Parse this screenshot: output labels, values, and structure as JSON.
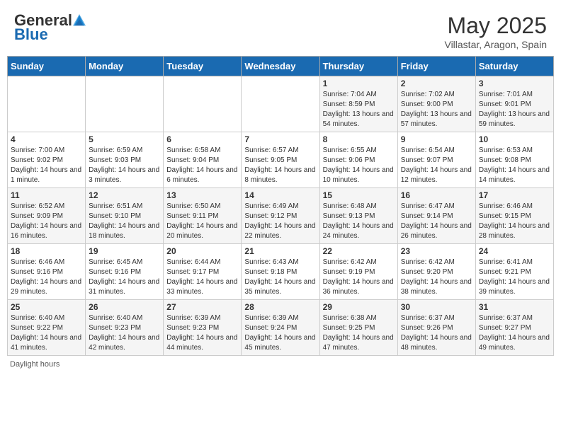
{
  "header": {
    "logo_general": "General",
    "logo_blue": "Blue",
    "month_year": "May 2025",
    "location": "Villastar, Aragon, Spain"
  },
  "days_of_week": [
    "Sunday",
    "Monday",
    "Tuesday",
    "Wednesday",
    "Thursday",
    "Friday",
    "Saturday"
  ],
  "footer": {
    "daylight_label": "Daylight hours"
  },
  "weeks": [
    [
      {
        "day": "",
        "content": ""
      },
      {
        "day": "",
        "content": ""
      },
      {
        "day": "",
        "content": ""
      },
      {
        "day": "",
        "content": ""
      },
      {
        "day": "1",
        "content": "Sunrise: 7:04 AM\nSunset: 8:59 PM\nDaylight: 13 hours and 54 minutes."
      },
      {
        "day": "2",
        "content": "Sunrise: 7:02 AM\nSunset: 9:00 PM\nDaylight: 13 hours and 57 minutes."
      },
      {
        "day": "3",
        "content": "Sunrise: 7:01 AM\nSunset: 9:01 PM\nDaylight: 13 hours and 59 minutes."
      }
    ],
    [
      {
        "day": "4",
        "content": "Sunrise: 7:00 AM\nSunset: 9:02 PM\nDaylight: 14 hours and 1 minute."
      },
      {
        "day": "5",
        "content": "Sunrise: 6:59 AM\nSunset: 9:03 PM\nDaylight: 14 hours and 3 minutes."
      },
      {
        "day": "6",
        "content": "Sunrise: 6:58 AM\nSunset: 9:04 PM\nDaylight: 14 hours and 6 minutes."
      },
      {
        "day": "7",
        "content": "Sunrise: 6:57 AM\nSunset: 9:05 PM\nDaylight: 14 hours and 8 minutes."
      },
      {
        "day": "8",
        "content": "Sunrise: 6:55 AM\nSunset: 9:06 PM\nDaylight: 14 hours and 10 minutes."
      },
      {
        "day": "9",
        "content": "Sunrise: 6:54 AM\nSunset: 9:07 PM\nDaylight: 14 hours and 12 minutes."
      },
      {
        "day": "10",
        "content": "Sunrise: 6:53 AM\nSunset: 9:08 PM\nDaylight: 14 hours and 14 minutes."
      }
    ],
    [
      {
        "day": "11",
        "content": "Sunrise: 6:52 AM\nSunset: 9:09 PM\nDaylight: 14 hours and 16 minutes."
      },
      {
        "day": "12",
        "content": "Sunrise: 6:51 AM\nSunset: 9:10 PM\nDaylight: 14 hours and 18 minutes."
      },
      {
        "day": "13",
        "content": "Sunrise: 6:50 AM\nSunset: 9:11 PM\nDaylight: 14 hours and 20 minutes."
      },
      {
        "day": "14",
        "content": "Sunrise: 6:49 AM\nSunset: 9:12 PM\nDaylight: 14 hours and 22 minutes."
      },
      {
        "day": "15",
        "content": "Sunrise: 6:48 AM\nSunset: 9:13 PM\nDaylight: 14 hours and 24 minutes."
      },
      {
        "day": "16",
        "content": "Sunrise: 6:47 AM\nSunset: 9:14 PM\nDaylight: 14 hours and 26 minutes."
      },
      {
        "day": "17",
        "content": "Sunrise: 6:46 AM\nSunset: 9:15 PM\nDaylight: 14 hours and 28 minutes."
      }
    ],
    [
      {
        "day": "18",
        "content": "Sunrise: 6:46 AM\nSunset: 9:16 PM\nDaylight: 14 hours and 29 minutes."
      },
      {
        "day": "19",
        "content": "Sunrise: 6:45 AM\nSunset: 9:16 PM\nDaylight: 14 hours and 31 minutes."
      },
      {
        "day": "20",
        "content": "Sunrise: 6:44 AM\nSunset: 9:17 PM\nDaylight: 14 hours and 33 minutes."
      },
      {
        "day": "21",
        "content": "Sunrise: 6:43 AM\nSunset: 9:18 PM\nDaylight: 14 hours and 35 minutes."
      },
      {
        "day": "22",
        "content": "Sunrise: 6:42 AM\nSunset: 9:19 PM\nDaylight: 14 hours and 36 minutes."
      },
      {
        "day": "23",
        "content": "Sunrise: 6:42 AM\nSunset: 9:20 PM\nDaylight: 14 hours and 38 minutes."
      },
      {
        "day": "24",
        "content": "Sunrise: 6:41 AM\nSunset: 9:21 PM\nDaylight: 14 hours and 39 minutes."
      }
    ],
    [
      {
        "day": "25",
        "content": "Sunrise: 6:40 AM\nSunset: 9:22 PM\nDaylight: 14 hours and 41 minutes."
      },
      {
        "day": "26",
        "content": "Sunrise: 6:40 AM\nSunset: 9:23 PM\nDaylight: 14 hours and 42 minutes."
      },
      {
        "day": "27",
        "content": "Sunrise: 6:39 AM\nSunset: 9:23 PM\nDaylight: 14 hours and 44 minutes."
      },
      {
        "day": "28",
        "content": "Sunrise: 6:39 AM\nSunset: 9:24 PM\nDaylight: 14 hours and 45 minutes."
      },
      {
        "day": "29",
        "content": "Sunrise: 6:38 AM\nSunset: 9:25 PM\nDaylight: 14 hours and 47 minutes."
      },
      {
        "day": "30",
        "content": "Sunrise: 6:37 AM\nSunset: 9:26 PM\nDaylight: 14 hours and 48 minutes."
      },
      {
        "day": "31",
        "content": "Sunrise: 6:37 AM\nSunset: 9:27 PM\nDaylight: 14 hours and 49 minutes."
      }
    ]
  ]
}
